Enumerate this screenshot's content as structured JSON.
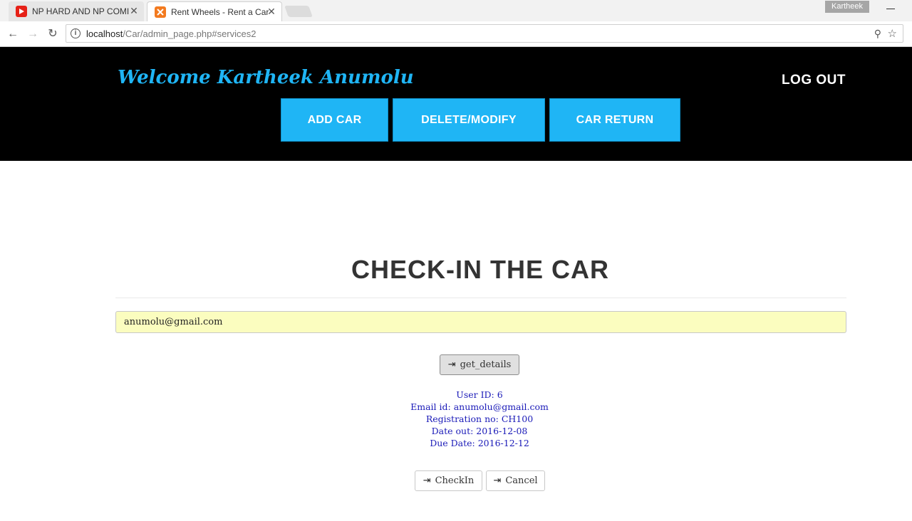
{
  "browser": {
    "tabs": [
      {
        "title": "NP HARD AND NP COMI",
        "favicon": "youtube-icon"
      },
      {
        "title": "Rent Wheels - Rent a Car",
        "favicon": "xampp-icon"
      }
    ],
    "profile_name": "Kartheek",
    "url_host": "localhost",
    "url_path": "/Car/admin_page.php#services2"
  },
  "header": {
    "welcome": "Welcome Kartheek Anumolu",
    "logout": "LOG OUT",
    "buttons": [
      "ADD CAR",
      "DELETE/MODIFY",
      "CAR RETURN"
    ]
  },
  "main": {
    "heading": "CHECK-IN THE CAR",
    "email_value": "anumolu@gmail.com",
    "get_details_label": "get_details",
    "details": [
      "User ID: 6",
      "Email id: anumolu@gmail.com",
      "Registration no: CH100",
      "Date out: 2016-12-08",
      "Due Date: 2016-12-12"
    ],
    "checkin_label": "CheckIn",
    "cancel_label": "Cancel"
  },
  "colors": {
    "accent": "#1fb5f5",
    "header_bg": "#000000",
    "details_text": "#1a1ab8",
    "input_bg": "#fbfdbf"
  }
}
